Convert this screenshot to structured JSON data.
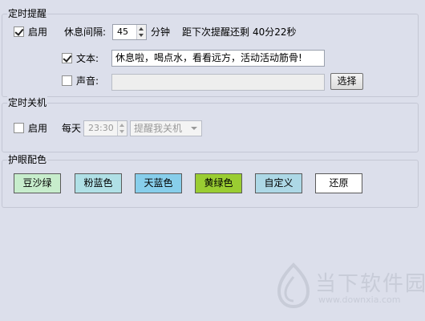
{
  "reminder": {
    "title": "定时提醒",
    "enable_label": "启用",
    "enabled": true,
    "interval_label": "休息间隔:",
    "interval_value": "45",
    "interval_unit": "分钟",
    "next_label": "距下次提醒还剩",
    "next_value": "40分22秒",
    "text_label": "文本:",
    "text_enabled": true,
    "text_value": "休息啦，喝点水，看看远方，活动活动筋骨!",
    "sound_label": "声音:",
    "sound_enabled": false,
    "sound_value": "",
    "choose_label": "选择"
  },
  "shutdown": {
    "title": "定时关机",
    "enable_label": "启用",
    "enabled": false,
    "daily_label": "每天",
    "time_value": "23:30",
    "action_value": "提醒我关机"
  },
  "eye_care": {
    "title": "护眼配色",
    "swatches": [
      {
        "label": "豆沙绿",
        "color": "#c7edcc"
      },
      {
        "label": "粉蓝色",
        "color": "#b0e0e6"
      },
      {
        "label": "天蓝色",
        "color": "#87ceeb"
      },
      {
        "label": "黄绿色",
        "color": "#9acd32"
      },
      {
        "label": "自定义",
        "color": "#add8e6"
      },
      {
        "label": "还原",
        "color": "#ffffff"
      }
    ]
  },
  "watermark": {
    "text": "当下软件园",
    "url": "www.downxia.com"
  }
}
